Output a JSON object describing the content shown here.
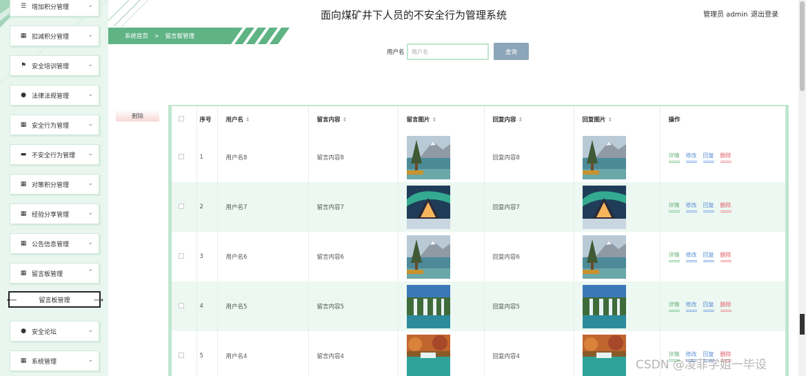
{
  "header": {
    "title": "面向煤矿井下人员的不安全行为管理系统",
    "admin": "管理员 admin",
    "logout": "退出登录"
  },
  "breadcrumb": {
    "home": "系统首页",
    "sep": ">",
    "current": "留言板管理"
  },
  "sidebar": {
    "items": [
      {
        "label": "增加积分管理",
        "icon": "list-icon"
      },
      {
        "label": "扣减积分管理",
        "icon": "grid-icon"
      },
      {
        "label": "安全培训管理",
        "icon": "flag-icon"
      },
      {
        "label": "法律法规管理",
        "icon": "location-icon"
      },
      {
        "label": "安全行为管理",
        "icon": "grid-icon"
      },
      {
        "label": "不安全行为管理",
        "icon": "briefcase-icon"
      },
      {
        "label": "对策积分管理",
        "icon": "grid-icon"
      },
      {
        "label": "经验分享管理",
        "icon": "table-icon"
      },
      {
        "label": "公告信息管理",
        "icon": "grid-icon"
      },
      {
        "label": "留言板管理",
        "icon": "grid-icon",
        "expanded": true
      },
      {
        "label": "安全论坛",
        "icon": "user-icon"
      },
      {
        "label": "系统管理",
        "icon": "grid-icon"
      }
    ],
    "sub_item": "留言板管理"
  },
  "search": {
    "label": "用户名",
    "placeholder": "用户名",
    "button": "查询"
  },
  "toolbar": {
    "delete": "删除"
  },
  "table": {
    "headers": {
      "index": "序号",
      "username": "用户名",
      "content": "留言内容",
      "image": "留言图片",
      "reply": "回复内容",
      "reply_image": "回复图片",
      "actions": "操作"
    },
    "actions": {
      "detail": "详情",
      "edit": "修改",
      "reply": "回复",
      "delete": "删除"
    },
    "rows": [
      {
        "index": "1",
        "username": "用户名8",
        "content": "留言内容8",
        "image": "lake-tree",
        "reply": "回复内容8",
        "reply_image": "lake-tree"
      },
      {
        "index": "2",
        "username": "用户名7",
        "content": "留言内容7",
        "image": "aurora-cabin",
        "reply": "回复内容7",
        "reply_image": "aurora-cabin"
      },
      {
        "index": "3",
        "username": "用户名6",
        "content": "留言内容6",
        "image": "lake-tree",
        "reply": "回复内容6",
        "reply_image": "lake-tree"
      },
      {
        "index": "4",
        "username": "用户名5",
        "content": "留言内容5",
        "image": "waterfall",
        "reply": "回复内容5",
        "reply_image": "waterfall"
      },
      {
        "index": "5",
        "username": "用户名4",
        "content": "留言内容4",
        "image": "autumn-lake",
        "reply": "回复内容4",
        "reply_image": "autumn-lake"
      }
    ]
  },
  "watermark": "CSDN @凌菲学姐一毕设",
  "colors": {
    "accent": "#5fb384",
    "sidebar_bg": "#e8f6ef",
    "even_row": "#ecf8f1",
    "search_button": "#8ca5b8",
    "delete": "#e0606a"
  }
}
